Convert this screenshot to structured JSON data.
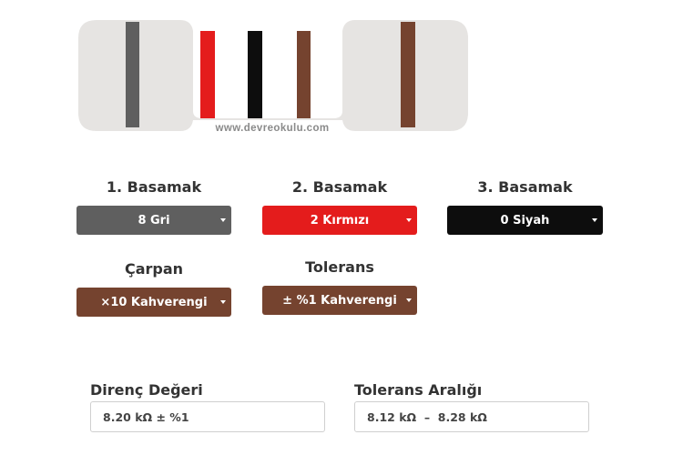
{
  "watermark": "www.devreokulu.com",
  "colors": {
    "gray": "#5f5f5f",
    "red": "#e41c1c",
    "black": "#0d0d0d",
    "brown": "#75432f",
    "body": "#e6e4e2"
  },
  "selectors": {
    "digit1": {
      "label": "1. Basamak",
      "value": "8 Gri"
    },
    "digit2": {
      "label": "2. Basamak",
      "value": "2 Kırmızı"
    },
    "digit3": {
      "label": "3. Basamak",
      "value": "0 Siyah"
    },
    "multiplier": {
      "label": "Çarpan",
      "value": "×10 Kahverengi"
    },
    "tolerance": {
      "label": "Tolerans",
      "value": "± %1 Kahverengi"
    }
  },
  "results": {
    "resistance": {
      "label": "Direnç Değeri",
      "value": "8.20 kΩ ± %1"
    },
    "tolerance_range": {
      "label": "Tolerans Aralığı",
      "value": "8.12 kΩ  –  8.28 kΩ"
    }
  }
}
